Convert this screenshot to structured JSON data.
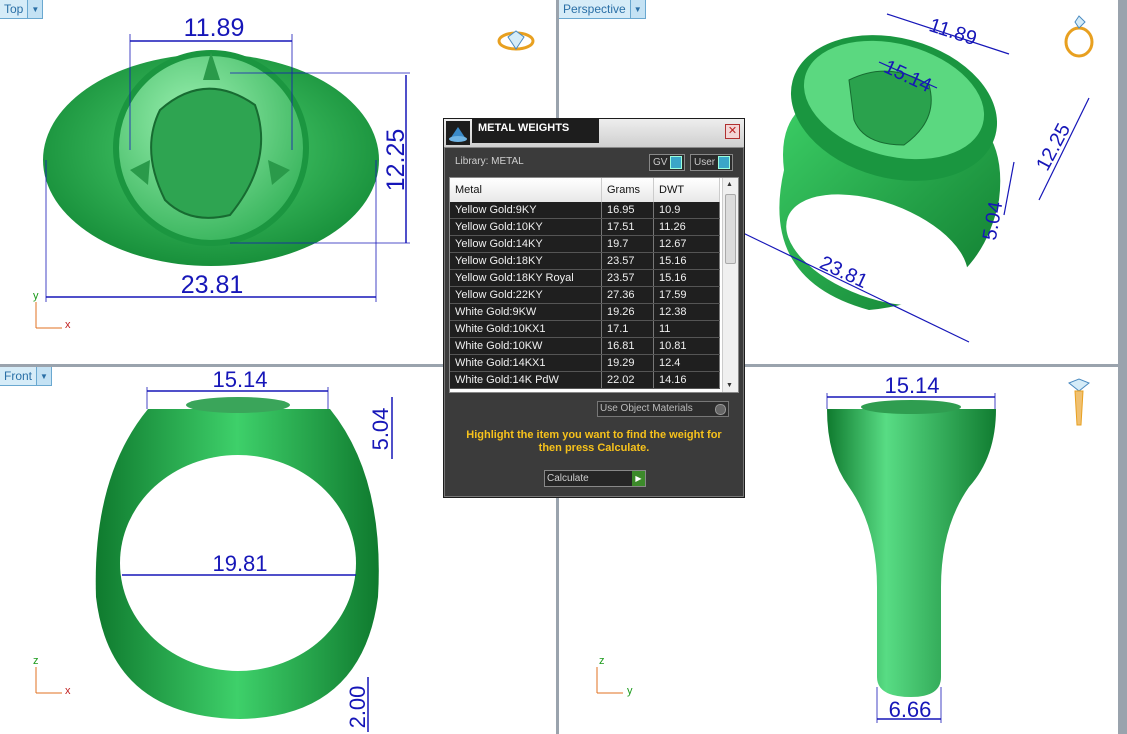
{
  "viewports": {
    "top": {
      "label": "Top",
      "dims": [
        "11.89",
        "12.25",
        "23.81"
      ],
      "axes": {
        "up": "y",
        "right": "x"
      }
    },
    "persp": {
      "label": "Perspective",
      "dims": [
        "11.89",
        "15.14",
        "12.25",
        "5.04",
        "23.81"
      ]
    },
    "front": {
      "label": "Front",
      "dims": [
        "15.14",
        "5.04",
        "19.81",
        "2.00"
      ],
      "axes": {
        "up": "z",
        "right": "x"
      }
    },
    "right": {
      "dims": [
        "15.14",
        "6.66"
      ],
      "axes": {
        "up": "z",
        "right": "y"
      }
    }
  },
  "dialog": {
    "title": "METAL WEIGHTS",
    "close": "✕",
    "library_label": "Library: METAL",
    "toggle_gv": "GV",
    "toggle_user": "User",
    "headers": [
      "Metal",
      "Grams",
      "DWT"
    ],
    "rows": [
      [
        "Yellow Gold:9KY",
        "16.95",
        "10.9"
      ],
      [
        "Yellow Gold:10KY",
        "17.51",
        "11.26"
      ],
      [
        "Yellow Gold:14KY",
        "19.7",
        "12.67"
      ],
      [
        "Yellow Gold:18KY",
        "23.57",
        "15.16"
      ],
      [
        "Yellow Gold:18KY Royal",
        "23.57",
        "15.16"
      ],
      [
        "Yellow Gold:22KY",
        "27.36",
        "17.59"
      ],
      [
        "White Gold:9KW",
        "19.26",
        "12.38"
      ],
      [
        "White Gold:10KX1",
        "17.1",
        "11"
      ],
      [
        "White Gold:10KW",
        "16.81",
        "10.81"
      ],
      [
        "White Gold:14KX1",
        "19.29",
        "12.4"
      ],
      [
        "White Gold:14K PdW",
        "22.02",
        "14.16"
      ]
    ],
    "use_object_materials": "Use Object Materials",
    "hint": "Highlight the item you want to find the weight for then press Calculate.",
    "calculate": "Calculate"
  },
  "colors": {
    "ring": "#1fa84a",
    "ring_light": "#6fe08c",
    "dim": "#1616b8",
    "accent": "#f7c21b"
  }
}
